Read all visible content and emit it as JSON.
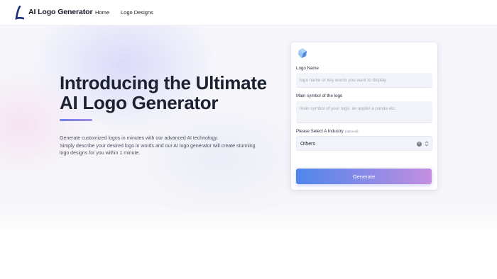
{
  "header": {
    "brand": "AI Logo Generator",
    "nav": {
      "home": "Home",
      "logo_designs": "Logo Designs"
    }
  },
  "hero": {
    "title_line1": "Introducing the Ultimate",
    "title_line2": "AI Logo Generator",
    "desc_line1": "Generate customized logos in minutes with our advanced AI technology.",
    "desc_line2": "Simply describe your desired logo in words and our AI logo generator will create stunning",
    "desc_line3": "logo designs for you within 1 minute."
  },
  "form": {
    "logo_name_label": "Logo Name",
    "logo_name_placeholder": "logo name or key words you want to display",
    "symbol_label": "Main symbol of the logo",
    "symbol_placeholder": "main symbol of your logo, an apple/ a panda etc.",
    "industry_label": "Please Select A Industry",
    "industry_optional": "(optional)",
    "industry_value": "Others",
    "generate_label": "Generate"
  },
  "colors": {
    "accent_start": "#4f86ec",
    "accent_end": "#c48fe0",
    "title_text": "#1c2130"
  }
}
